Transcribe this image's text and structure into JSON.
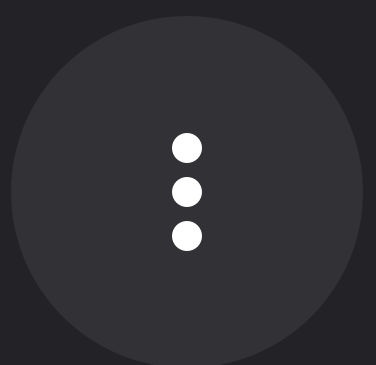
{
  "button": {
    "icon": "more-vertical-icon",
    "background_color": "#323236",
    "dot_color": "#ffffff"
  },
  "page": {
    "background_color": "#232327"
  }
}
